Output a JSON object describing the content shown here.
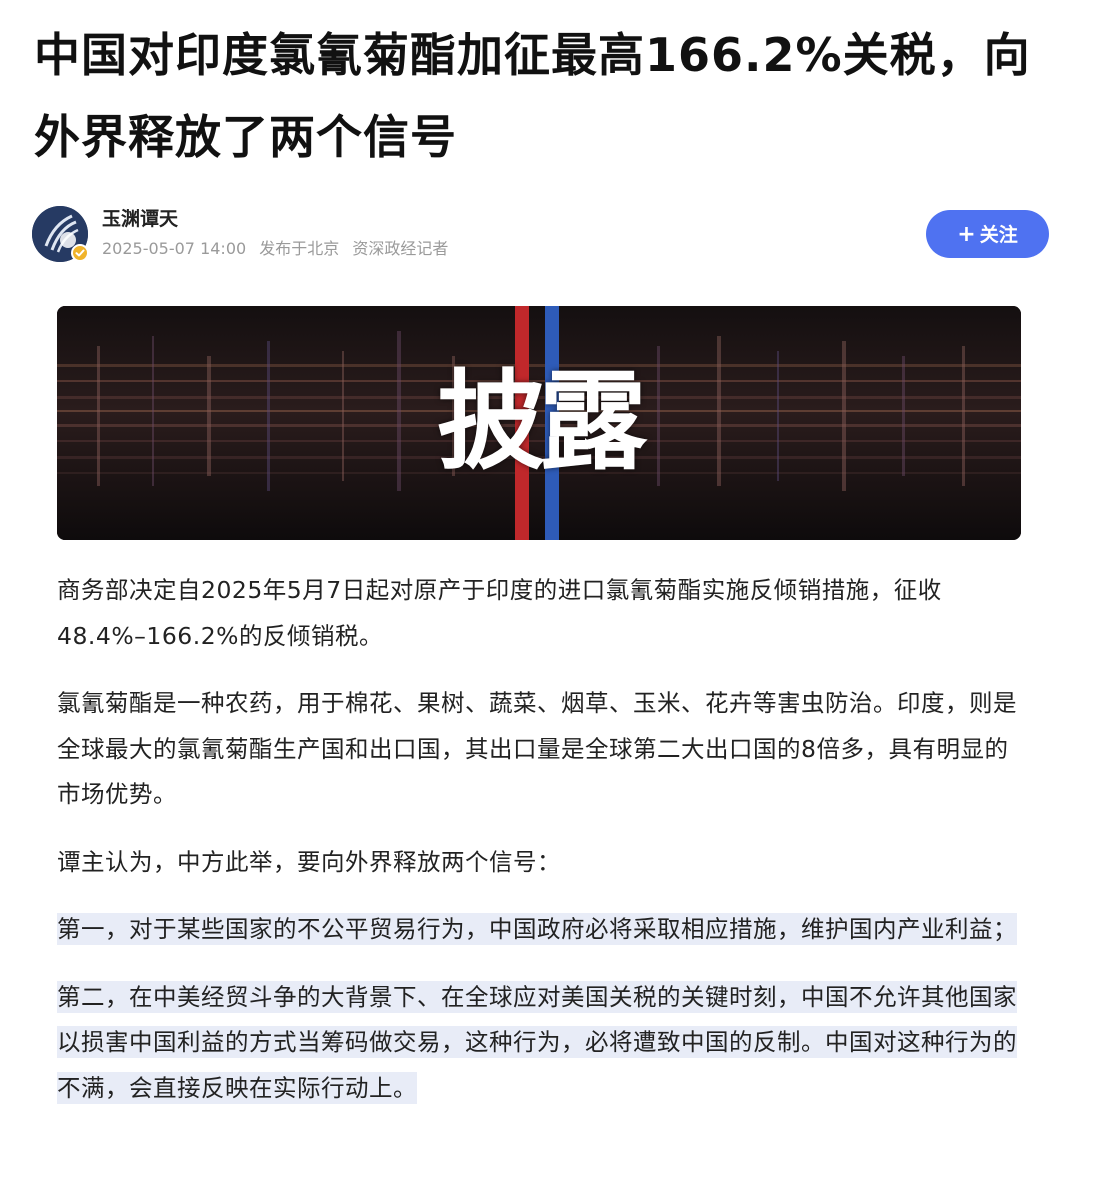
{
  "article": {
    "title": "中国对印度氯氰菊酯加征最高166.2%关税，向外界释放了两个信号",
    "author": {
      "name": "玉渊谭天",
      "date": "2025-05-07 14:00",
      "location": "发布于北京",
      "tag": "资深政经记者",
      "follow_label": "关注",
      "follow_plus": "+"
    },
    "banner": {
      "text": "披露"
    },
    "paragraphs": [
      "商务部决定自2025年5月7日起对原产于印度的进口氯氰菊酯实施反倾销措施，征收48.4%–166.2%的反倾销税。",
      "氯氰菊酯是一种农药，用于棉花、果树、蔬菜、烟草、玉米、花卉等害虫防治。印度，则是全球最大的氯氰菊酯生产国和出口国，其出口量是全球第二大出口国的8倍多，具有明显的市场优势。",
      "谭主认为，中方此举，要向外界释放两个信号：",
      "第一，对于某些国家的不公平贸易行为，中国政府必将采取相应措施，维护国内产业利益；",
      "第二，在中美经贸斗争的大背景下、在全球应对美国关税的关键时刻，中国不允许其他国家以损害中国利益的方式当筹码做交易，这种行为，必将遭致中国的反制。中国对这种行为的不满，会直接反映在实际行动上。"
    ]
  },
  "colors": {
    "follow_button": "#4f72f1",
    "highlight": "#e8ecf7",
    "banner_red_line": "#c0282b",
    "banner_blue_line": "#2e5bb8",
    "verified_badge": "#f0b32a"
  },
  "icons": {
    "avatar": "avatar-logo",
    "verified": "verified-check-icon"
  }
}
